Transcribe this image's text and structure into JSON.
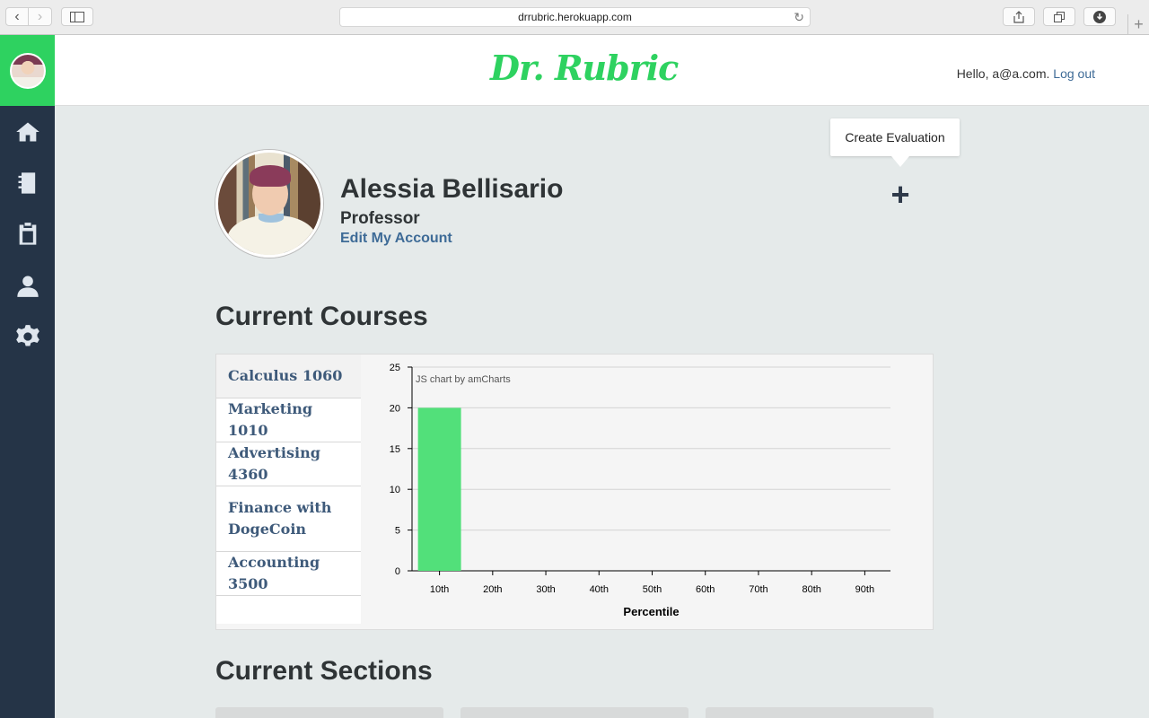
{
  "browser": {
    "url": "drrubric.herokuapp.com"
  },
  "header": {
    "logo": "Dr. Rubric",
    "greeting": "Hello, a@a.com.",
    "logout_label": "Log out"
  },
  "sidebar": {
    "items": [
      {
        "icon": "home-icon"
      },
      {
        "icon": "notebook-icon"
      },
      {
        "icon": "clipboard-icon"
      },
      {
        "icon": "user-icon"
      },
      {
        "icon": "gear-icon"
      }
    ]
  },
  "profile": {
    "name": "Alessia Bellisario",
    "role": "Professor",
    "edit_label": "Edit My Account"
  },
  "create": {
    "tooltip": "Create Evaluation",
    "plus": "+"
  },
  "courses": {
    "title": "Current Courses",
    "items": [
      "Calculus 1060",
      "Marketing 1010",
      "Advertising 4360",
      "Finance with DogeCoin",
      "Accounting 3500"
    ]
  },
  "sections": {
    "title": "Current Sections"
  },
  "chart_data": {
    "type": "bar",
    "credit": "JS chart by amCharts",
    "categories": [
      "10th",
      "20th",
      "30th",
      "40th",
      "50th",
      "60th",
      "70th",
      "80th",
      "90th"
    ],
    "values": [
      20,
      0,
      0,
      0,
      0,
      0,
      0,
      0,
      0
    ],
    "xlabel": "Percentile",
    "ylabel": "",
    "ylim": [
      0,
      25
    ],
    "yticks": [
      0,
      5,
      10,
      15,
      20,
      25
    ],
    "grid": true,
    "bar_color": "#52e07a"
  }
}
